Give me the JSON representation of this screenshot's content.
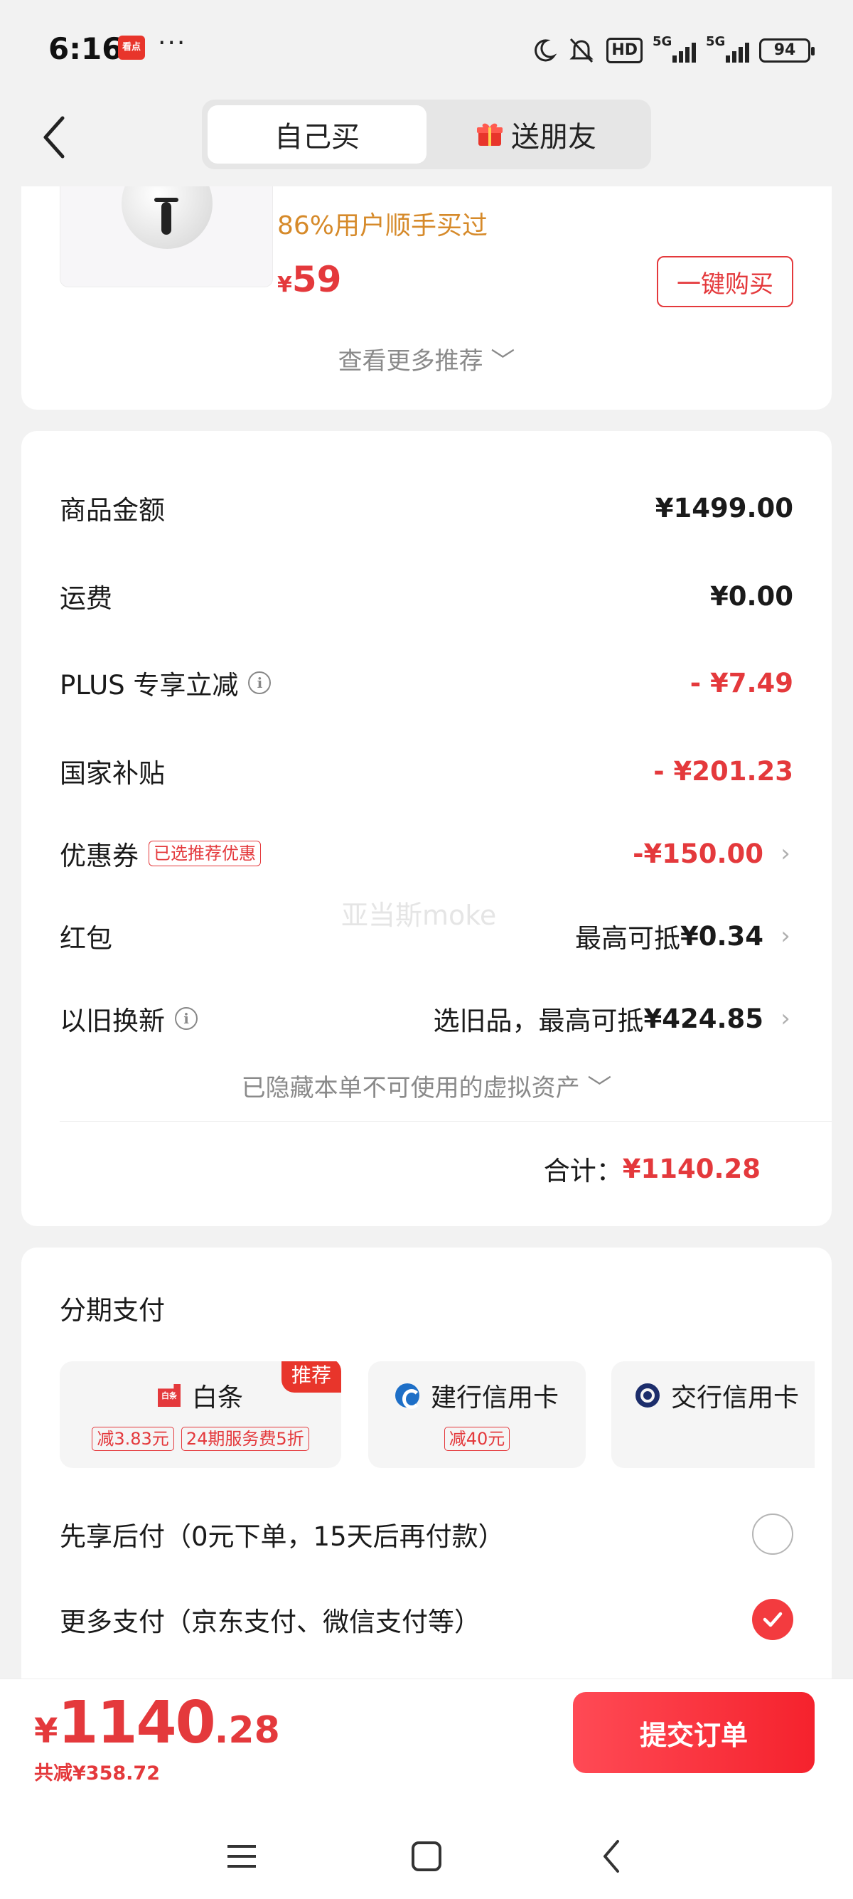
{
  "status_bar": {
    "time": "6:16",
    "app_icon_text": "看点",
    "more": "···",
    "hd": "HD",
    "signal1": "5G",
    "signal2": "5G",
    "battery": "94"
  },
  "nav": {
    "tab_self": "自己买",
    "tab_gift": "送朋友"
  },
  "recommendation": {
    "tag": "86%用户顺手买过",
    "price_symbol": "¥",
    "price": "59",
    "buy_label": "一键购买",
    "more_label": "查看更多推荐 ﹀"
  },
  "price_detail": {
    "items": [
      {
        "label": "商品金额",
        "value": "¥1499.00"
      },
      {
        "label": "运费",
        "value": "¥0.00"
      },
      {
        "label": "PLUS 专享立减",
        "value": "- ¥7.49"
      },
      {
        "label": "国家补贴",
        "value": "- ¥201.23"
      },
      {
        "label": "优惠券",
        "badge": "已选推荐优惠",
        "value": "-¥150.00"
      },
      {
        "label": "红包",
        "value_prefix": "最高可抵",
        "value": "¥0.34"
      },
      {
        "label": "以旧换新",
        "value_prefix": "选旧品，最高可抵",
        "value": "¥424.85"
      }
    ],
    "watermark": "亚当斯moke",
    "hidden_note": "已隐藏本单不可使用的虚拟资产 ﹀",
    "total_label": "合计：",
    "total_value": "¥1140.28"
  },
  "payment": {
    "title": "分期支付",
    "options": [
      {
        "name": "白条",
        "icon": "baitiao-icon",
        "icon_text": "白条",
        "tags": [
          "减3.83元",
          "24期服务费5折"
        ],
        "ribbon": "推荐"
      },
      {
        "name": "建行信用卡",
        "icon": "ccb-icon",
        "tags": [
          "减40元"
        ]
      },
      {
        "name": "交行信用卡",
        "icon": "bocom-icon",
        "tags": []
      }
    ],
    "pay_later": "先享后付（0元下单，15天后再付款）",
    "more_pay": "更多支付（京东支付、微信支付等）"
  },
  "bottom_bar": {
    "symbol": "¥",
    "int": "1140",
    "dec": ".28",
    "saved": "共减¥358.72",
    "submit": "提交订单"
  },
  "colors": {
    "accent": "#e4393c",
    "tag_orange": "#d68a2a"
  }
}
